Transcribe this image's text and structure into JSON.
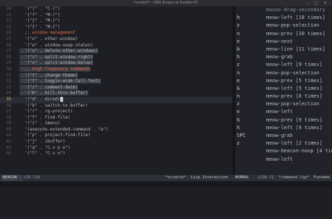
{
  "window": {
    "title": "*scratch* - GNU Emacs at Kamiko-PC",
    "controls": "– ▢ ✕"
  },
  "editor": {
    "lines": [
      {
        "n": "20",
        "text": "  '(\")\" . \"C-)\")",
        "style": ""
      },
      {
        "n": "21",
        "text": "  '(\"?\" . \"M-?\")",
        "style": ""
      },
      {
        "n": "22",
        "text": "  '(\"}\" . \"M-}\")",
        "style": ""
      },
      {
        "n": "23",
        "text": "  '(\"{\" . \"M-{\")",
        "style": ""
      },
      {
        "n": "24",
        "text": "  ;; window management",
        "style": "comment"
      },
      {
        "n": "25",
        "text": "  '(\"o\" . other-window)",
        "style": ""
      },
      {
        "n": "26",
        "text": "  '(\"w\" . window-swap-states)",
        "style": ""
      },
      {
        "n": "27",
        "text": "  '(\"x\" . delete-other-windows)",
        "style": "sel"
      },
      {
        "n": "28",
        "text": "  '(\"c\" . split-window-right)",
        "style": "sel"
      },
      {
        "n": "29",
        "text": "  '(\"v\" . split-window-below)",
        "style": "sel"
      },
      {
        "n": "30",
        "text": "  ;; high frequency commands",
        "style": "comment sel"
      },
      {
        "n": "31",
        "text": "  '(\"t\" . change-theme)",
        "style": "sel"
      },
      {
        "n": "32",
        "text": "  '(\"f\" . toggle-wide-tall-font)",
        "style": "sel"
      },
      {
        "n": "33",
        "text": "  '(\"/\" . comment-dwim)",
        "style": "sel"
      },
      {
        "n": "34",
        "text": "  '(\"K\" . kill-this-buffer)",
        "style": "sel"
      },
      {
        "n": "35",
        "text": "  '(\"d\" . dired)",
        "style": "cur"
      },
      {
        "n": "36",
        "text": "  '(\"b\" . switch-to-buffer)",
        "style": ""
      },
      {
        "n": "37",
        "text": "  '(\"r\" . rg-project)",
        "style": ""
      },
      {
        "n": "38",
        "text": "  '(\"f\" . find-file)",
        "style": ""
      },
      {
        "n": "39",
        "text": "  '(\"i\" . imenu)",
        "style": ""
      },
      {
        "n": "40",
        "text": "  '(execute-extended-command . \"a\")",
        "style": ""
      },
      {
        "n": "41",
        "text": "  '(\"p\" . project-find-file)",
        "style": ""
      },
      {
        "n": "42",
        "text": "  '(\"j\" . ibuffer)",
        "style": ""
      },
      {
        "n": "43",
        "text": "  '(\"q\" . \"C-x p o\")",
        "style": ""
      },
      {
        "n": "44",
        "text": "  '(\"l\" . \"C-x o\")",
        "style": ""
      }
    ]
  },
  "keylog": {
    "rows": [
      {
        "key": "",
        "cmd": "mouse-drag-secondary"
      },
      {
        "key": "h",
        "cmd": "meow-left [18 times]"
      },
      {
        "key": "z",
        "cmd": "meow-pop-selection"
      },
      {
        "key": "n",
        "cmd": "meow-prev [10 times]"
      },
      {
        "key": "e",
        "cmd": "meow-next"
      },
      {
        "key": "b",
        "cmd": "meow-line [11 times]"
      },
      {
        "key": "h",
        "cmd": "meow-grab"
      },
      {
        "key": "z",
        "cmd": "meow-left [9 times]"
      },
      {
        "key": "n",
        "cmd": "meow-pop-selection"
      },
      {
        "key": "e",
        "cmd": "meow-prev [5 times]"
      },
      {
        "key": "G",
        "cmd": "meow-left [5 times]"
      },
      {
        "key": "n",
        "cmd": "meow-prev [6 times]"
      },
      {
        "key": "z",
        "cmd": "meow-pop-selection"
      },
      {
        "key": "e",
        "cmd": "meow-left"
      },
      {
        "key": "G",
        "cmd": "meow-prev [9 times]"
      },
      {
        "key": "h",
        "cmd": "meow-left [9 times]"
      },
      {
        "key": "SPC",
        "cmd": "meow-grab"
      },
      {
        "key": "z",
        "cmd": "meow-left [2 times]"
      },
      {
        "key": "",
        "cmd": "meow-beacon-noop [4 times]"
      },
      {
        "key": "",
        "cmd": "meow-left"
      }
    ]
  },
  "modeline": {
    "state": "BEACON",
    "position": "L35 C15",
    "buffer": "*scratch*  Lisp Interaction",
    "state2": "NORMAL",
    "position2": "L238 C1",
    "buffer2": "*command-log*  Fundame"
  },
  "colors": {
    "accent_comment": "#e06c4c",
    "background": "#1e1f24"
  }
}
